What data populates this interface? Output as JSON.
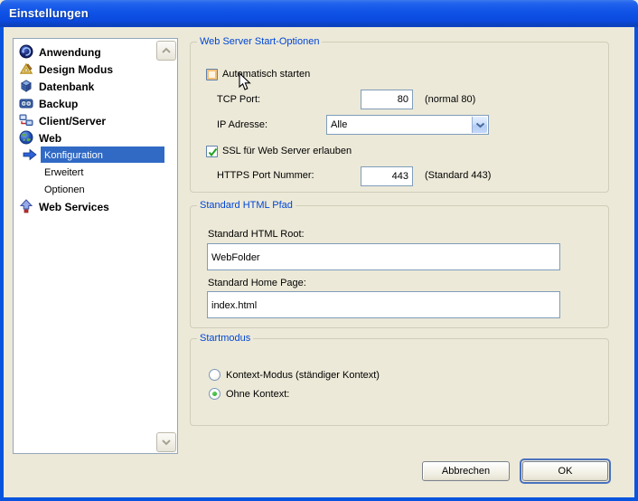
{
  "window": {
    "title": "Einstellungen"
  },
  "sidebar": {
    "items": [
      {
        "label": "Anwendung",
        "icon": "app-icon",
        "level": 0,
        "selected": false
      },
      {
        "label": "Design Modus",
        "icon": "design-icon",
        "level": 0,
        "selected": false
      },
      {
        "label": "Datenbank",
        "icon": "database-icon",
        "level": 0,
        "selected": false
      },
      {
        "label": "Backup",
        "icon": "backup-icon",
        "level": 0,
        "selected": false
      },
      {
        "label": "Client/Server",
        "icon": "client-server-icon",
        "level": 0,
        "selected": false
      },
      {
        "label": "Web",
        "icon": "web-icon",
        "level": 0,
        "selected": false
      },
      {
        "label": "Konfiguration",
        "icon": "arrow-right-icon",
        "level": 1,
        "selected": true
      },
      {
        "label": "Erweitert",
        "icon": "",
        "level": 1,
        "selected": false
      },
      {
        "label": "Optionen",
        "icon": "",
        "level": 1,
        "selected": false
      },
      {
        "label": "Web Services",
        "icon": "web-services-icon",
        "level": 0,
        "selected": false
      }
    ]
  },
  "groups": {
    "start_options": {
      "title": "Web Server Start-Optionen",
      "auto_start": {
        "label": "Automatisch starten",
        "checked": false,
        "hovered": true
      },
      "tcp_port": {
        "label": "TCP Port:",
        "value": "80",
        "hint": "(normal 80)"
      },
      "ip_address": {
        "label": "IP Adresse:",
        "value": "Alle"
      },
      "ssl": {
        "label": "SSL für Web Server erlauben",
        "checked": true
      },
      "https_port": {
        "label": "HTTPS Port Nummer:",
        "value": "443",
        "hint": "(Standard 443)"
      }
    },
    "html_path": {
      "title": "Standard HTML Pfad",
      "root": {
        "label": "Standard HTML Root:",
        "value": "WebFolder"
      },
      "home": {
        "label": "Standard Home Page:",
        "value": "index.html"
      }
    },
    "start_mode": {
      "title": "Startmodus",
      "context": {
        "label": "Kontext-Modus (ständiger Kontext)",
        "selected": false
      },
      "no_context": {
        "label": "Ohne Kontext:",
        "selected": true
      }
    }
  },
  "buttons": {
    "cancel": "Abbrechen",
    "ok": "OK"
  },
  "colors": {
    "dialog_bg": "#ECE9D8",
    "titlebar_blue": "#0F52E6",
    "window_border": "#0854DE",
    "group_title": "#0046D5",
    "selection": "#316AC5",
    "input_border": "#7F9DB9",
    "check_green": "#21A121",
    "hover_amber": "#F6C078"
  }
}
